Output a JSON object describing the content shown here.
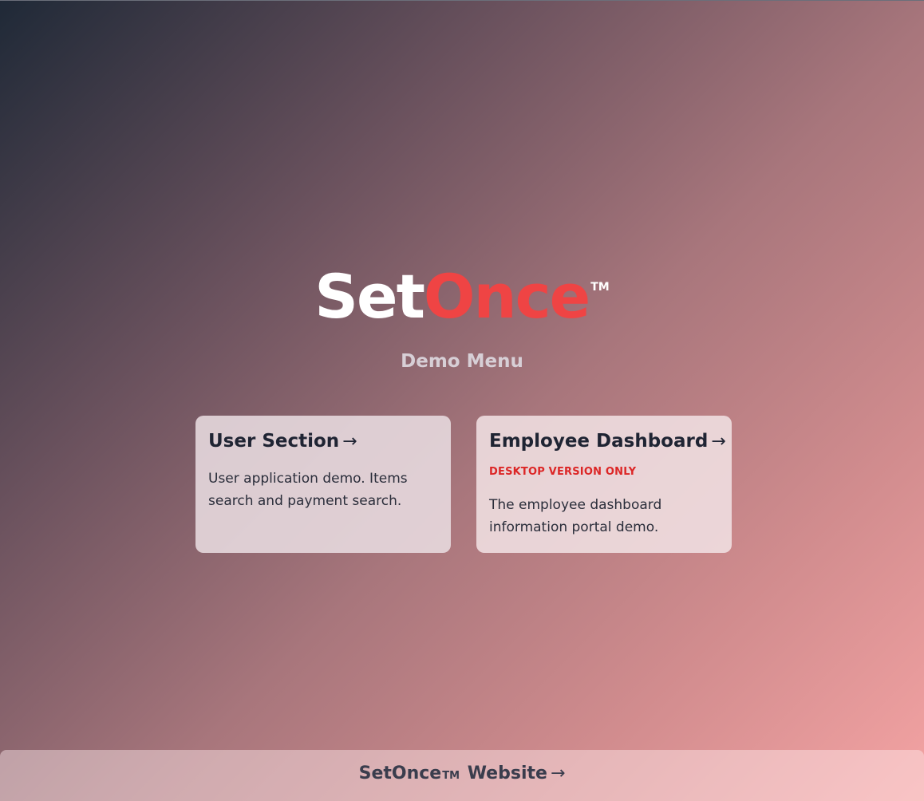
{
  "brand": {
    "name_part1": "Set",
    "name_part2": "Once",
    "trademark": "TM",
    "accent_color": "#ef4444"
  },
  "subtitle": "Demo Menu",
  "cards": [
    {
      "title": "User Section",
      "arrow": "→",
      "description": "User application demo. Items search and payment search."
    },
    {
      "title": "Employee Dashboard",
      "arrow": "→",
      "badge": "DESKTOP VERSION ONLY",
      "badge_color": "#dc2626",
      "description": "The employee dashboard information portal demo."
    }
  ],
  "footer": {
    "brand": "SetOnce",
    "trademark": "TM",
    "label": "Website",
    "arrow": "→"
  }
}
